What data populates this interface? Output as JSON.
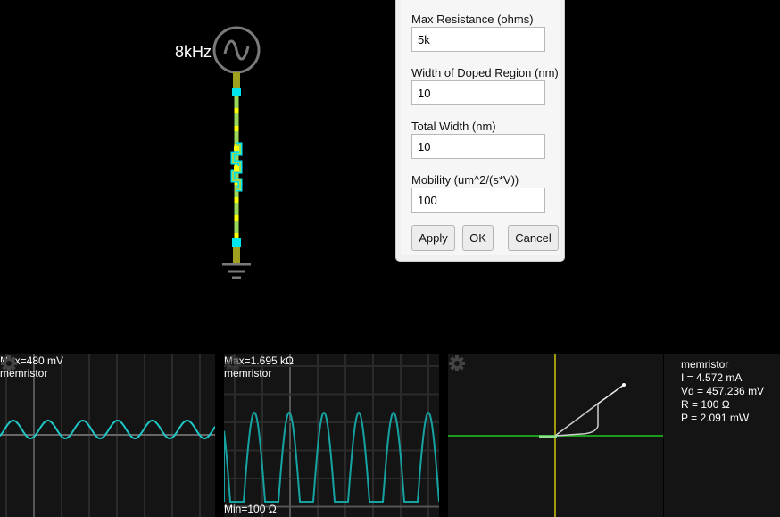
{
  "circuit": {
    "source_label": "8kHz",
    "components": [
      "ac-voltage-source",
      "memristor",
      "ground"
    ]
  },
  "dialog": {
    "fields": [
      {
        "label": "Max Resistance (ohms)",
        "value": "5k"
      },
      {
        "label": "Width of Doped Region (nm)",
        "value": "10"
      },
      {
        "label": "Total Width (nm)",
        "value": "10"
      },
      {
        "label": "Mobility (um^2/(s*V))",
        "value": "100"
      }
    ],
    "apply_label": "Apply",
    "ok_label": "OK",
    "cancel_label": "Cancel"
  },
  "scopes": [
    {
      "max_label": "Max=480 mV",
      "name": "memristor",
      "trace": "voltage-sine",
      "color": "#1fc7c7"
    },
    {
      "max_label": "Max=1.695 kΩ",
      "min_label": "Min=100 Ω",
      "name": "memristor",
      "trace": "resistance",
      "color": "#17a2a2"
    },
    {
      "name": "memristor",
      "trace": "I-V-plot",
      "x_axis_color": "#1a9c1a",
      "y_axis_color": "#a09a10"
    }
  ],
  "info": {
    "name": "memristor",
    "lines": [
      "I = 4.572 mA",
      "Vd = 457.236 mV",
      "R = 100 Ω",
      "P = 2.091 mW"
    ]
  }
}
